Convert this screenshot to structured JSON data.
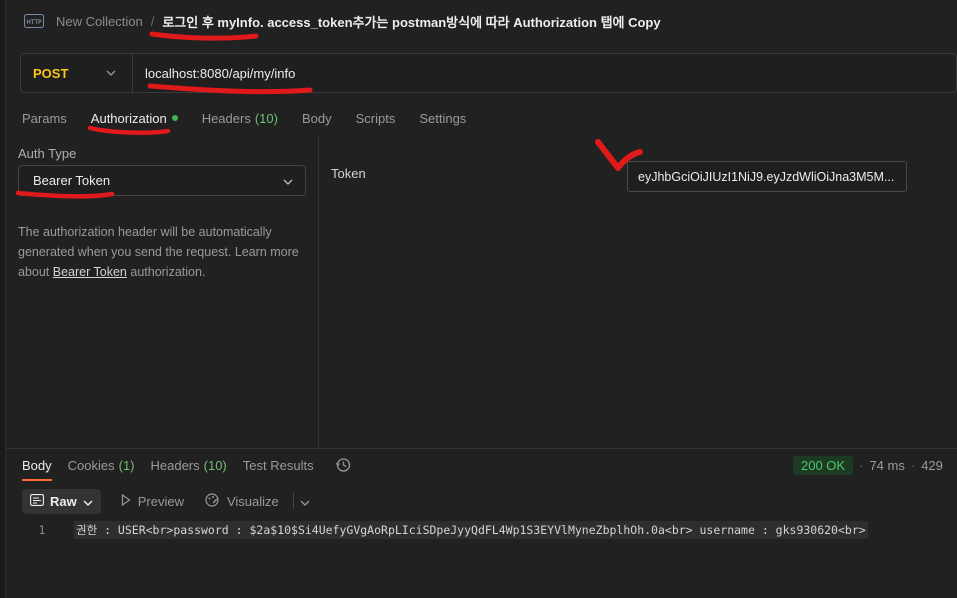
{
  "header": {
    "protocol_icon": "http-icon",
    "collection": "New Collection",
    "separator": "/",
    "request_name": "로그인 후 myInfo. access_token추가는 postman방식에 따라 Authorization 탭에 Copy"
  },
  "request": {
    "method": "POST",
    "url": "localhost:8080/api/my/info"
  },
  "request_tabs": [
    {
      "label": "Params",
      "count": ""
    },
    {
      "label": "Authorization",
      "count": "",
      "active": true,
      "indicator": "green-dot"
    },
    {
      "label": "Headers",
      "count": "(10)"
    },
    {
      "label": "Body",
      "count": ""
    },
    {
      "label": "Scripts",
      "count": ""
    },
    {
      "label": "Settings",
      "count": ""
    }
  ],
  "auth": {
    "type_label": "Auth Type",
    "type_value": "Bearer Token",
    "desc_part1": "The authorization header will be automatically generated when you send the request. Learn more about ",
    "desc_link": "Bearer Token",
    "desc_part2": " authorization.",
    "token_label": "Token",
    "token_value": "eyJhbGciOiJIUzI1NiJ9.eyJzdWliOiJna3M5M..."
  },
  "response": {
    "tabs": [
      {
        "label": "Body",
        "count": "",
        "active": true
      },
      {
        "label": "Cookies",
        "count": "(1)"
      },
      {
        "label": "Headers",
        "count": "(10)"
      },
      {
        "label": "Test Results",
        "count": ""
      }
    ],
    "status": "200 OK",
    "time": "74 ms",
    "size": "429",
    "view_mode": "Raw",
    "preview_label": "Preview",
    "visualize_label": "Visualize",
    "line_number": "1",
    "body_text": "권한 : USER<br>password : $2a$10$Si4UefyGVgAoRpLIciSDpeJyyQdFL4Wp1S3EYVlMyneZbplhOh.0a<br> username : gks930620<br>"
  },
  "colors": {
    "background": "#212121",
    "method": "#fcc419",
    "status_ok": "#4ec96a",
    "accent": "#ff6c37",
    "annotation": "#e0191a"
  }
}
